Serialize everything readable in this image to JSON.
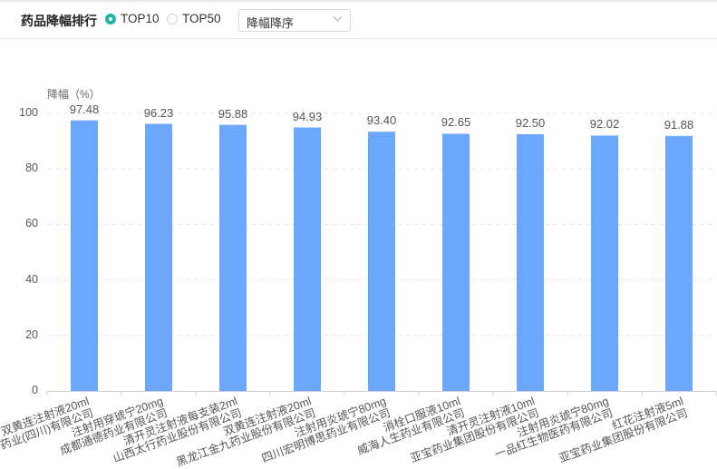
{
  "header": {
    "title": "药品降幅排行",
    "radio": [
      {
        "label": "TOP10",
        "checked": true
      },
      {
        "label": "TOP50",
        "checked": false
      }
    ],
    "sort_select": "降幅降序"
  },
  "chart_data": {
    "type": "bar",
    "ylabel": "降幅（%）",
    "ylim": [
      0,
      100
    ],
    "yticks": [
      "0",
      "20",
      "40",
      "60",
      "80",
      "100"
    ],
    "bar_color": "#6aa7fd",
    "categories": [
      {
        "drug": "双黄连注射液20ml",
        "company": "药业(四川)有限公司"
      },
      {
        "drug": "注射用穿琥宁20mg",
        "company": "成都通德药业有限公司"
      },
      {
        "drug": "清开灵注射液每支装2ml",
        "company": "山西太行药业股份有限公司"
      },
      {
        "drug": "双黄连注射液20ml",
        "company": "黑龙江金九药业股份有限公司"
      },
      {
        "drug": "注射用炎琥宁80mg",
        "company": "四川宏明博思药业有限公司"
      },
      {
        "drug": "消栓口服液10ml",
        "company": "威海人生药业有限公司"
      },
      {
        "drug": "清开灵注射液10ml",
        "company": "亚宝药业集团股份有限公司"
      },
      {
        "drug": "注射用炎琥宁80mg",
        "company": "一品红生物医药有限公司"
      },
      {
        "drug": "红花注射液5ml",
        "company": "亚宝药业集团股份有限公司"
      }
    ],
    "values": [
      97.48,
      96.23,
      95.88,
      94.93,
      93.4,
      92.65,
      92.5,
      92.02,
      91.88
    ],
    "value_labels": [
      "97.48",
      "96.23",
      "95.88",
      "94.93",
      "93.40",
      "92.65",
      "92.50",
      "92.02",
      "91.88"
    ]
  }
}
